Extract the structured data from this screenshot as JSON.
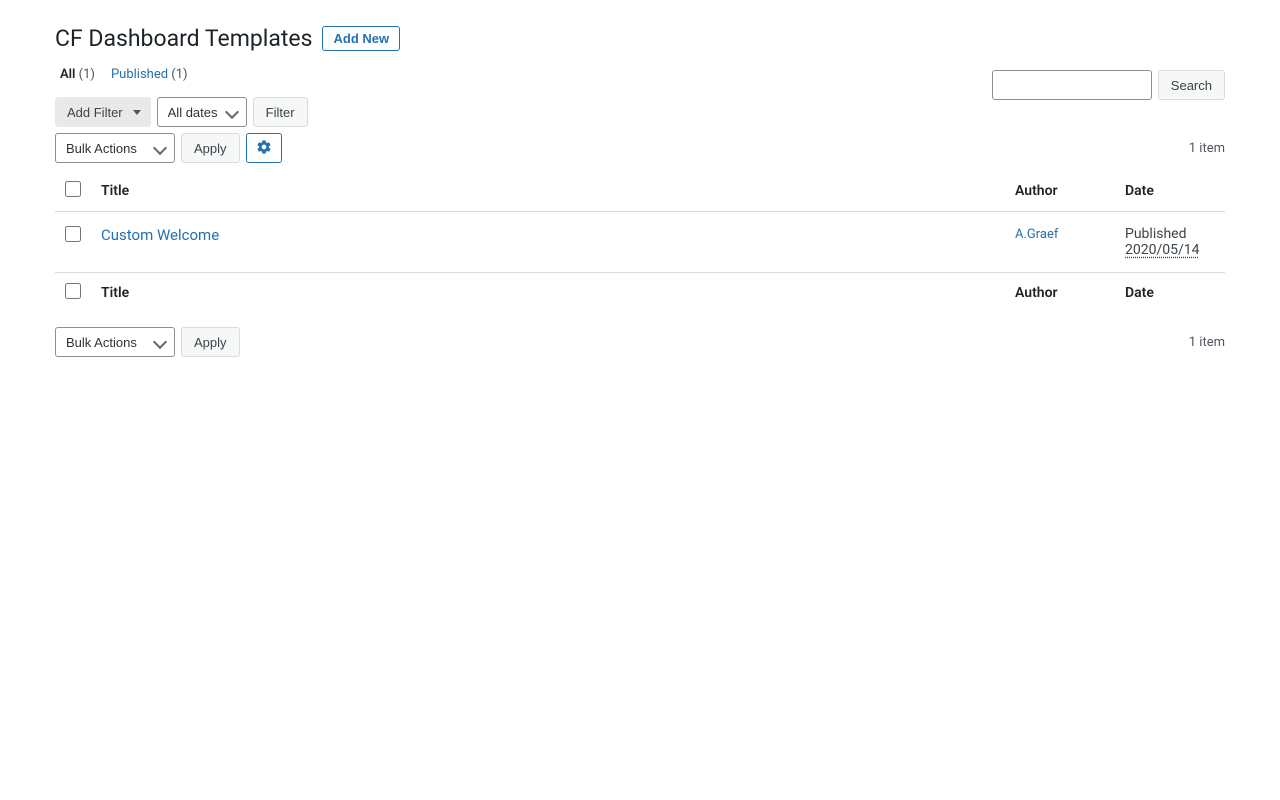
{
  "header": {
    "title": "CF Dashboard Templates",
    "add_new": "Add New"
  },
  "subsubsub": {
    "all_label": "All",
    "all_count": "(1)",
    "published_label": "Published",
    "published_count": "(1)"
  },
  "search": {
    "button": "Search"
  },
  "filters": {
    "add_filter": "Add Filter",
    "date_filter": "All dates",
    "filter_btn": "Filter"
  },
  "bulk": {
    "label": "Bulk Actions",
    "apply": "Apply"
  },
  "count": {
    "text": "1 item"
  },
  "table": {
    "headers": {
      "title": "Title",
      "author": "Author",
      "date": "Date"
    },
    "rows": [
      {
        "title": "Custom Welcome",
        "author": "A.Graef",
        "status": "Published",
        "date": "2020/05/14"
      }
    ]
  }
}
